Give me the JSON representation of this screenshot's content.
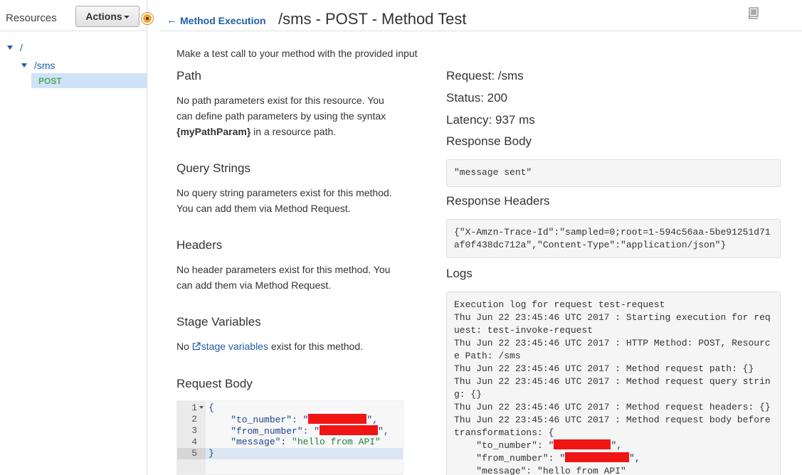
{
  "sidebar": {
    "title": "Resources",
    "actions_label": "Actions",
    "tree": {
      "root": "/",
      "sms": "/sms",
      "post": "POST"
    }
  },
  "header": {
    "back_label": "Method Execution",
    "title": "/sms - POST - Method Test",
    "book_icon": "book-icon"
  },
  "intro": "Make a test call to your method with the provided input",
  "path": {
    "heading": "Path",
    "line1": "No path parameters exist for this resource. You",
    "line2": "can define path parameters by using the syntax",
    "bold": "{myPathParam}",
    "line3_rest": " in a resource path."
  },
  "query": {
    "heading": "Query Strings",
    "line1": "No query string parameters exist for this method.",
    "line2": "You can add them via Method Request."
  },
  "headers": {
    "heading": "Headers",
    "line1": "No header parameters exist for this method. You",
    "line2": "can add them via Method Request."
  },
  "stage": {
    "heading": "Stage Variables",
    "prefix": "No ",
    "link": "stage variables",
    "suffix": " exist for this method."
  },
  "request_body": {
    "heading": "Request Body",
    "lines": [
      {
        "num": "1",
        "code": "{"
      },
      {
        "num": "2",
        "key": "    \"to_number\": \"",
        "tail": "\","
      },
      {
        "num": "3",
        "key": "    \"from_number\": \"",
        "tail": "\","
      },
      {
        "num": "4",
        "key": "    \"message\": ",
        "value": "\"hello from API\""
      },
      {
        "num": "5",
        "code": "}"
      }
    ]
  },
  "result": {
    "request": "Request: /sms",
    "status": "Status: 200",
    "latency": "Latency: 937 ms",
    "body_heading": "Response Body",
    "body": "\"message sent\"",
    "headers_heading": "Response Headers",
    "headers_line1": "{\"X-Amzn-Trace-Id\":\"sampled=0;root=1-594c56aa-5be91251d71",
    "headers_line2": "af0f438dc712a\",\"Content-Type\":\"application/json\"}",
    "logs_heading": "Logs",
    "logs": [
      "Execution log for request test-request",
      "Thu Jun 22 23:45:46 UTC 2017 : Starting execution for req",
      "uest: test-invoke-request",
      "Thu Jun 22 23:45:46 UTC 2017 : HTTP Method: POST, Resourc",
      "e Path: /sms",
      "Thu Jun 22 23:45:46 UTC 2017 : Method request path: {}",
      "Thu Jun 22 23:45:46 UTC 2017 : Method request query strin",
      "g: {}",
      "Thu Jun 22 23:45:46 UTC 2017 : Method request headers: {}",
      "Thu Jun 22 23:45:46 UTC 2017 : Method request body before",
      "transformations: {",
      "    \"to_number\": \"",
      "    \"from_number\": \"",
      "    \"message\": \"hello from API\""
    ]
  },
  "colors": {
    "link": "#1f5fa8",
    "post_method": "#4caf50",
    "selected_row": "#cfe2f7",
    "redaction": "#f01414",
    "drag_handle": "#f0a32f"
  }
}
